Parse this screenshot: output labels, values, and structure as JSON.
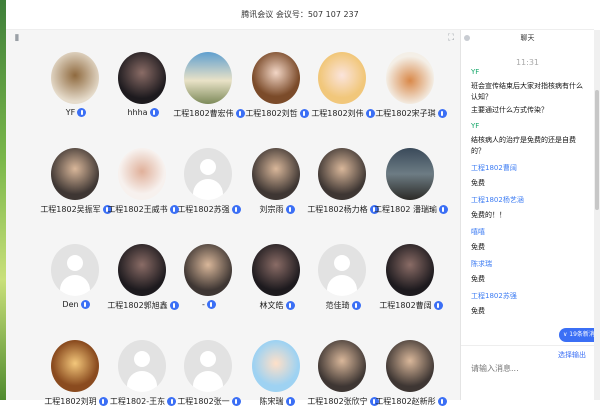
{
  "window": {
    "title": "腾讯会议 会议号：507 107 237"
  },
  "toolbar": {
    "pin_icon": "pin-icon",
    "fullscreen_icon": "expand-icon"
  },
  "participants": [
    {
      "name": "YF",
      "avatar": "animal-photo"
    },
    {
      "name": "hhha",
      "avatar": "dark-portrait"
    },
    {
      "name": "工程1802曹宏伟",
      "avatar": "outdoor-photo"
    },
    {
      "name": "工程1802刘哲",
      "avatar": "anime-boy"
    },
    {
      "name": "工程1802刘伟",
      "avatar": "anime-girl"
    },
    {
      "name": "工程1802宋子琪",
      "avatar": "dog-photo"
    },
    {
      "name": "工程1802吴振军",
      "avatar": "portrait"
    },
    {
      "name": "工程1802王威书",
      "avatar": "cartoon-bear"
    },
    {
      "name": "工程1802苏强",
      "avatar": "placeholder"
    },
    {
      "name": "刘宗雨",
      "avatar": "portrait"
    },
    {
      "name": "工程1802杨力格",
      "avatar": "portrait"
    },
    {
      "name": "工程1802 潘瑞瑜",
      "avatar": "landscape"
    },
    {
      "name": "Den",
      "avatar": "placeholder"
    },
    {
      "name": "工程1802郭旭鑫",
      "avatar": "dark-portrait"
    },
    {
      "name": "-",
      "avatar": "portrait"
    },
    {
      "name": "林文皓",
      "avatar": "dark-portrait"
    },
    {
      "name": "范佳琦",
      "avatar": "placeholder"
    },
    {
      "name": "工程1802曹阔",
      "avatar": "dark-portrait"
    },
    {
      "name": "工程1802刘玥",
      "avatar": "warm-photo"
    },
    {
      "name": "工程1802-王东",
      "avatar": "placeholder"
    },
    {
      "name": "工程1802张一",
      "avatar": "placeholder"
    },
    {
      "name": "陈宋瑞",
      "avatar": "cartoon-boy"
    },
    {
      "name": "工程1802张欣宁",
      "avatar": "portrait"
    },
    {
      "name": "工程1802赵新彤",
      "avatar": "portrait"
    }
  ],
  "chat": {
    "header": "聊天",
    "time": "11:31",
    "messages": [
      {
        "sender": "YF",
        "lines": [
          "班会宣传结束后大家对指核病有什么认知？",
          "主要通过什么方式传染？"
        ]
      },
      {
        "sender": "YF",
        "lines": [
          "结核病人的治疗是免费的还是自费的？"
        ]
      },
      {
        "sender": "工程1802曹阔",
        "lines": [
          "免费"
        ]
      },
      {
        "sender": "工程1802杨艺涵",
        "lines": [
          "免费的！！"
        ]
      },
      {
        "sender": "嘻嘻",
        "lines": [
          "免费"
        ]
      },
      {
        "sender": "陈求瑞",
        "lines": [
          "免费"
        ]
      },
      {
        "sender": "工程1802苏强",
        "lines": [
          "免费"
        ]
      }
    ],
    "unread_badge": "∨ 19条新消息",
    "link_label": "选择输出",
    "input_placeholder": "请输入消息..."
  }
}
